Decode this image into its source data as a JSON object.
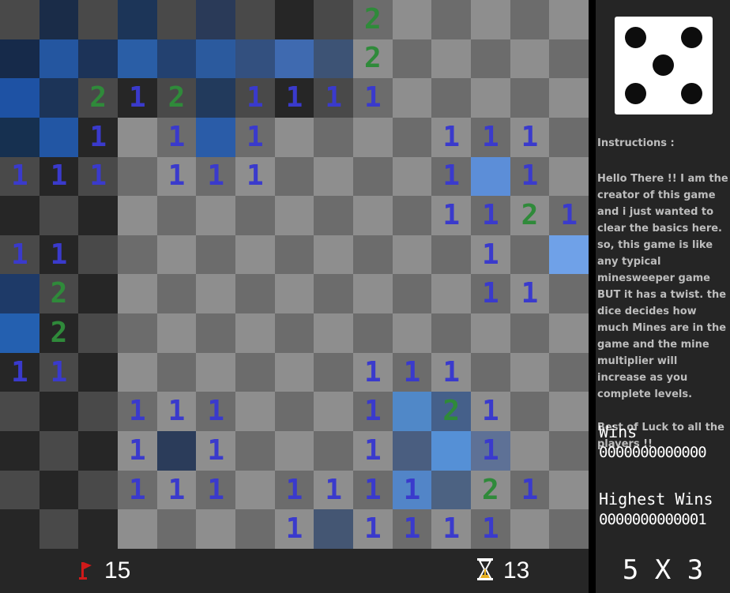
{
  "board": {
    "cols": 15,
    "rows": [
      "......#.#2.....",
      "......#.#2.....",
      "..212.1111.....",
      "..1.1.1....111.",
      "111.111....1.1.",
      "...........1121",
      "11..........1#.",
      ".2..........11.",
      ".2.............",
      "11.......111...",
      "...111...1#21..",
      "...1.1...1#.1..",
      "...111.1111.21.",
      ".......1.1111.."
    ],
    "tints": {
      "3-0": "#163050",
      "0-1": "#1a2c48",
      "0-3": "#1c3558",
      "0-5": "#2a3a58",
      "1-0": "#162a4a",
      "1-1": "#2456a0",
      "1-2": "#1c3358",
      "1-3": "#2a5ea6",
      "1-4": "#234170",
      "1-5": "#2b5a9e",
      "1-6": "#33507f",
      "1-7": "#3f6ab0",
      "1-8": "#3d5375",
      "2-0": "#1e52a4",
      "2-1": "#1c3458",
      "2-5": "#223a5c",
      "3-1": "#2256a4",
      "3-5": "#2a5ca8",
      "6-14": "#6fa1e8",
      "4-12": "#5c8ed8",
      "7-0": "#1e3a68",
      "8-0": "#2460b0",
      "10-10": "#5088c8",
      "10-11": "#45608a",
      "11-4": "#2b3c5a",
      "11-10": "#4a5e80",
      "11-11": "#5590d6",
      "11-12": "#5e7196",
      "12-10": "#5285c8",
      "12-11": "#4c6282",
      "13-8": "#445673"
    }
  },
  "colors": {
    "dark_cell": "#262626",
    "light_cell": "#494949",
    "revealed_dark": "#6c6c6c",
    "revealed_light": "#8e8e8e",
    "border_revealed_dark": "#787878",
    "border_revealed_light": "#9e9e9e",
    "number_1": "#3a3acc",
    "number_2": "#2f8a3a",
    "flag": "#d01a1a"
  },
  "status": {
    "flags_remaining": "15",
    "timer": "13"
  },
  "dice": {
    "value": 5
  },
  "panel": {
    "instructions_title": "Instructions :",
    "instructions_text": "Hello There !! I am the creator of this game and i just wanted to clear the basics here. so, this game is like any typical minesweeper game BUT it has a twist. the dice decides how much Mines are in the game and the mine multiplier will increase as you complete levels.\n\nBest of Luck to all the players  !!",
    "wins_label": "Wins",
    "wins_value": "0000000000000",
    "highest_wins_label": "Highest Wins",
    "highest_wins_value": "0000000000001",
    "grid_size": "5 X 3"
  },
  "icons": {
    "flag": "flag-icon",
    "timer": "hourglass-icon",
    "dice": "dice-icon"
  }
}
